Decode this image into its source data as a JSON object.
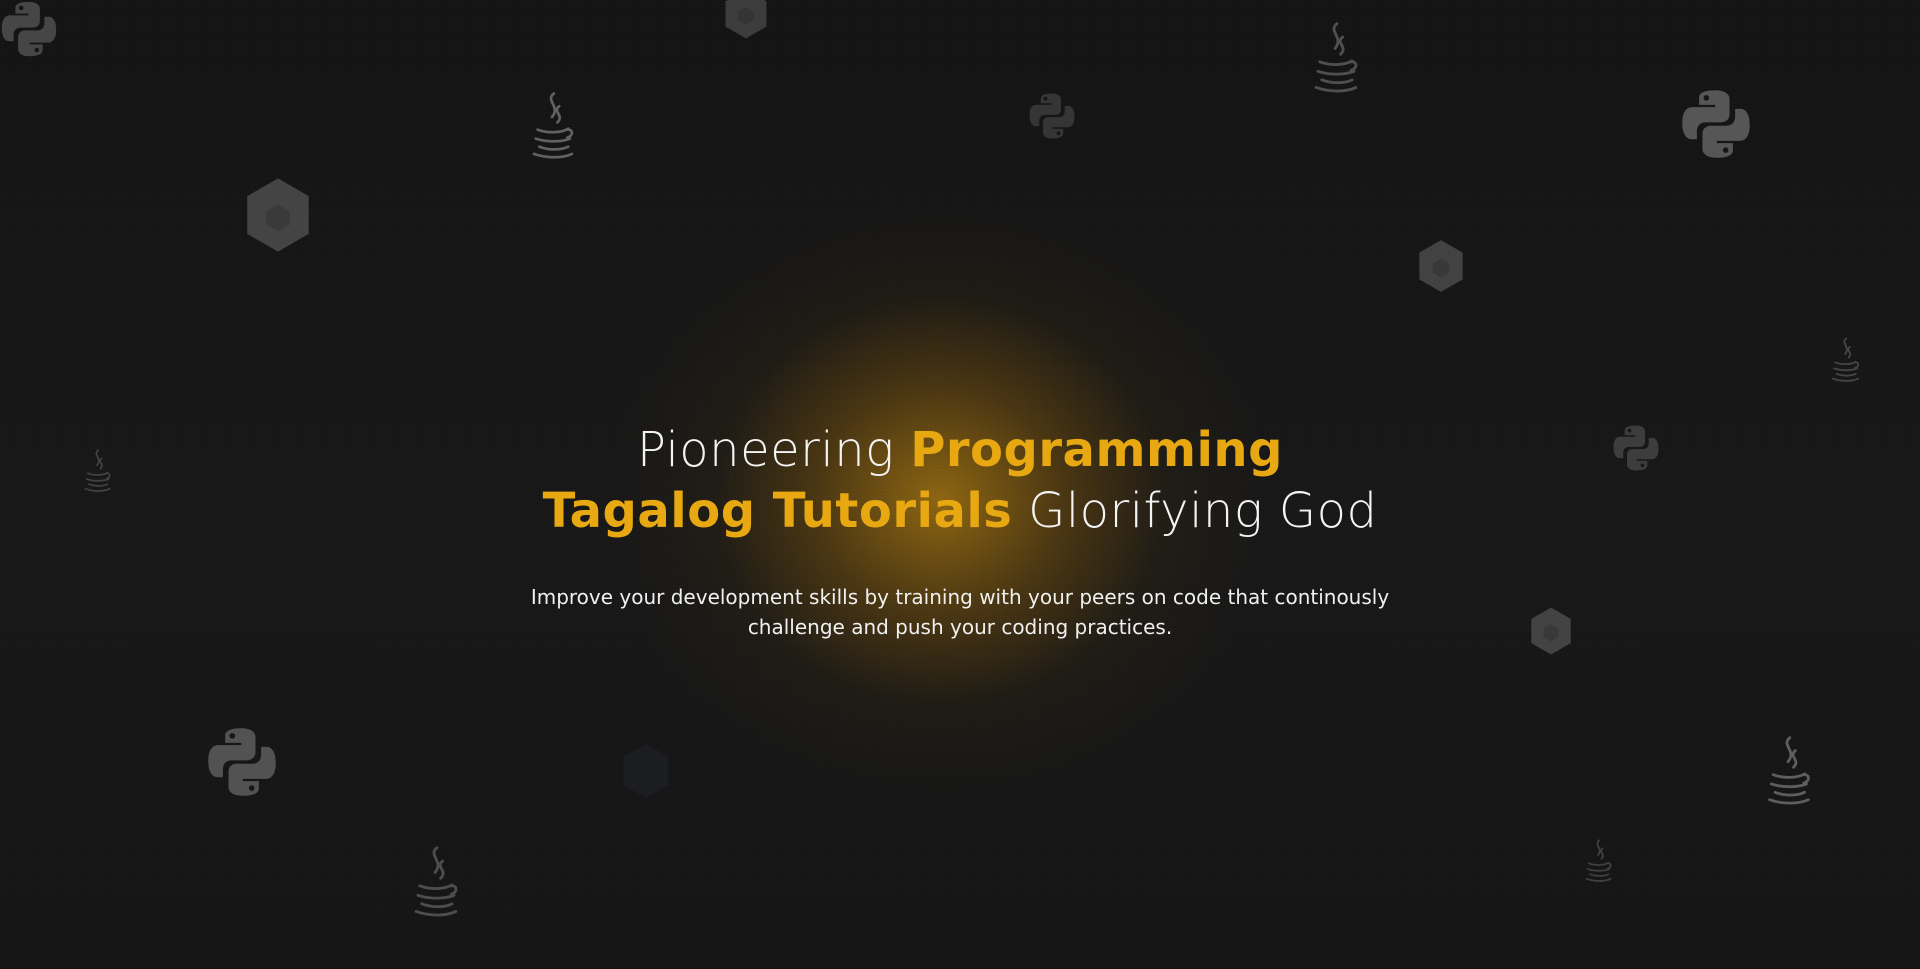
{
  "hero": {
    "headline_line1_plain": "Pioneering",
    "headline_line1_accent": "Programming",
    "headline_line2_accent": "Tagalog Tutorials",
    "headline_line2_plain": "Glorifying God",
    "subtext_line1": "Improve your development skills by training with your peers on code that continously",
    "subtext_line2": "challenge and push your coding practices."
  },
  "theme": {
    "background": "#161616",
    "accent": "#e8a812",
    "glow": "#d6960e",
    "icon_color": "#5b5b5b",
    "text": "#f3f3f3"
  },
  "decorations": {
    "icons": [
      "python-icon",
      "java-icon",
      "nodejs-hexagon-icon"
    ]
  }
}
